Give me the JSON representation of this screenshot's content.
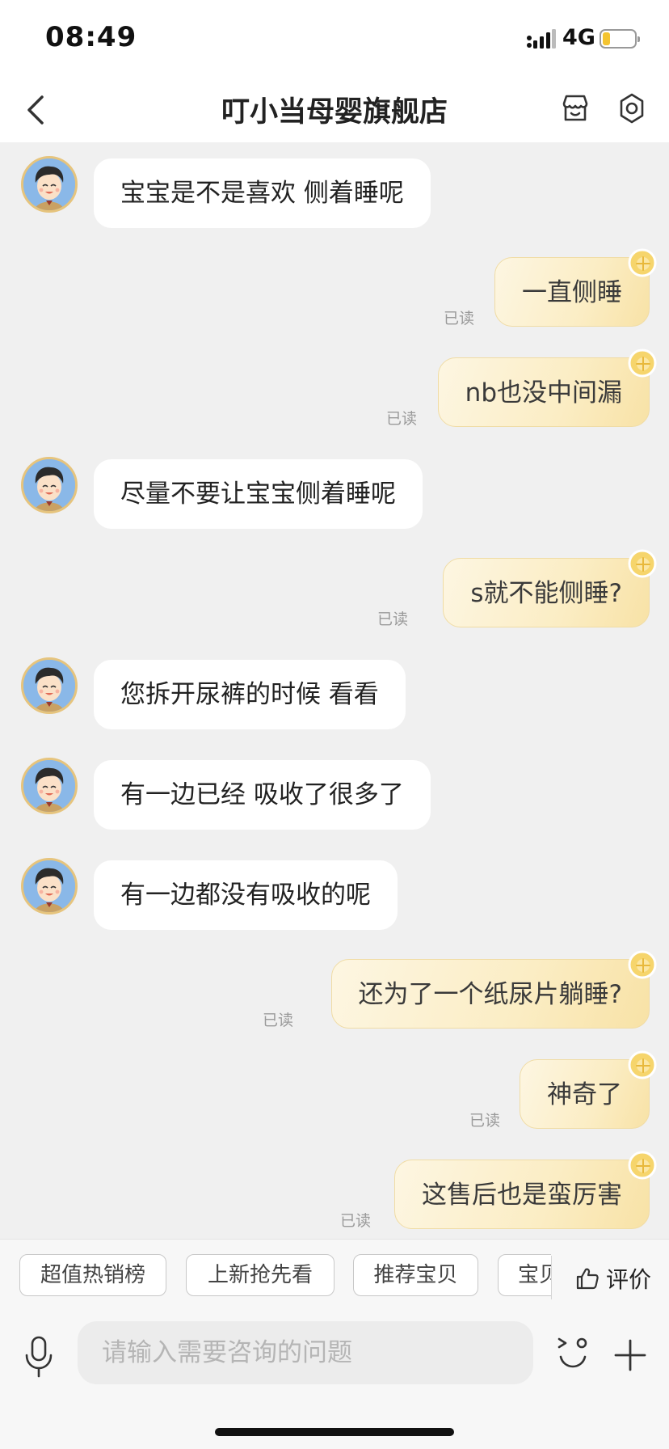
{
  "status_bar": {
    "time": "08:49",
    "network": "4G"
  },
  "header": {
    "title": "叮小当母婴旗舰店"
  },
  "read_label": "已读",
  "messages": [
    {
      "side": "received",
      "text": "宝宝是不是喜欢 侧着睡呢"
    },
    {
      "side": "sent",
      "text": "一直侧睡",
      "status": "已读"
    },
    {
      "side": "sent",
      "text": "nb也没中间漏",
      "status": "已读"
    },
    {
      "side": "received",
      "text": "尽量不要让宝宝侧着睡呢"
    },
    {
      "side": "sent",
      "text": "s就不能侧睡?",
      "status": "已读"
    },
    {
      "side": "received",
      "text": "您拆开尿裤的时候 看看"
    },
    {
      "side": "received",
      "text": "有一边已经 吸收了很多了"
    },
    {
      "side": "received",
      "text": "有一边都没有吸收的呢"
    },
    {
      "side": "sent",
      "text": "还为了一个纸尿片躺睡?",
      "status": "已读"
    },
    {
      "side": "sent",
      "text": "神奇了",
      "status": "已读"
    },
    {
      "side": "sent",
      "text": "这售后也是蛮厉害",
      "status": "已读"
    }
  ],
  "quick_replies": [
    "超值热销榜",
    "上新抢先看",
    "推荐宝贝",
    "宝贝"
  ],
  "rate_label": "评价",
  "input": {
    "placeholder": "请输入需要咨询的问题"
  },
  "colors": {
    "sent_bubble": "#fbedc4",
    "received_bubble": "#ffffff",
    "background": "#f0f0f0",
    "battery": "#f4c430"
  }
}
